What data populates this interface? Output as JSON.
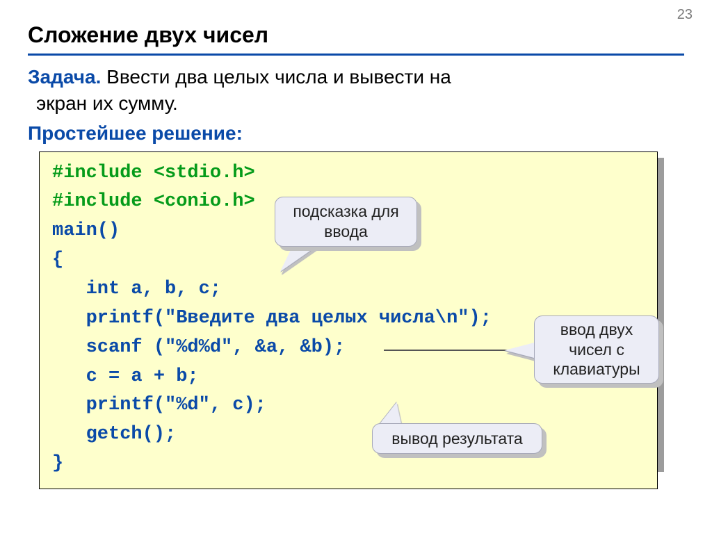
{
  "page_number": "23",
  "title": "Сложение двух чисел",
  "task": {
    "label": "Задача.",
    "text_line1": " Ввести два целых числа и вывести на",
    "text_line2": "экран их сумму."
  },
  "solution_label": "Простейшее решение:",
  "code": {
    "include1": "#include <stdio.h>",
    "include2": "#include <conio.h>",
    "main": "main()",
    "brace_open": "{",
    "line1": "   int a, b, c;",
    "line2": "   printf(\"Введите два целых числа\\n\");",
    "line3": "   scanf (\"%d%d\", &a, &b);",
    "line4": "   c = a + b;",
    "line5": "   printf(\"%d\", c);",
    "line6": "   getch();",
    "brace_close": "}"
  },
  "callouts": {
    "hint_input": "подсказка для ввода",
    "input_two": "ввод двух чисел с клавиатуры",
    "output_result": "вывод результата"
  }
}
